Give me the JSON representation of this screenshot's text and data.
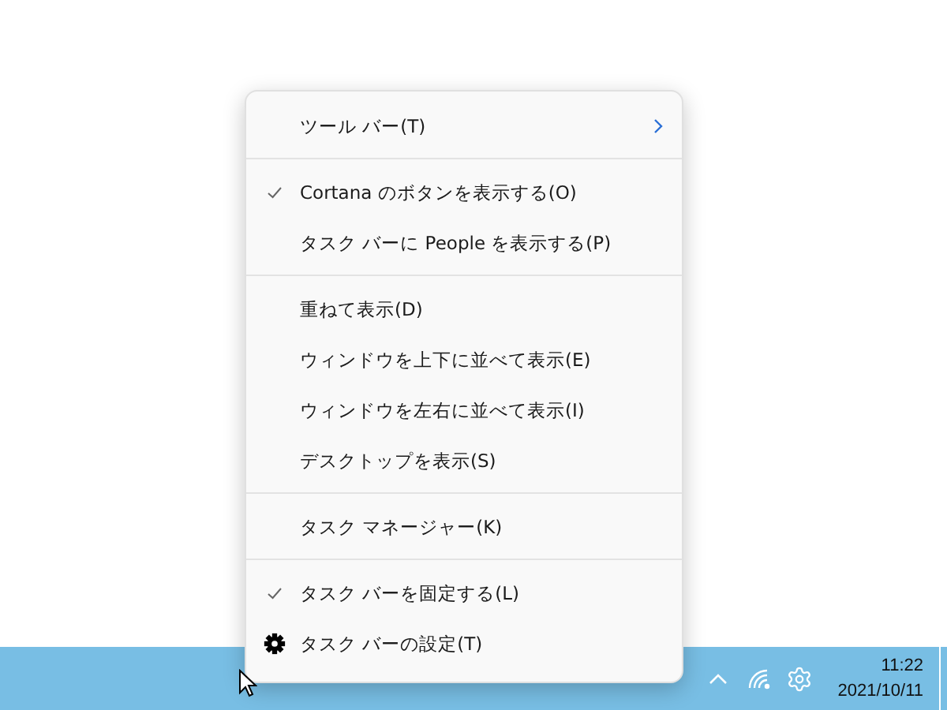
{
  "context_menu": {
    "items": [
      {
        "kind": "item",
        "label": "ツール バー(T)",
        "checked": false,
        "submenu": true,
        "icon": false
      },
      {
        "kind": "separator"
      },
      {
        "kind": "item",
        "label": "Cortana のボタンを表示する(O)",
        "checked": true,
        "submenu": false,
        "icon": false
      },
      {
        "kind": "item",
        "label": "タスク バーに People を表示する(P)",
        "checked": false,
        "submenu": false,
        "icon": false
      },
      {
        "kind": "separator"
      },
      {
        "kind": "item",
        "label": "重ねて表示(D)",
        "checked": false,
        "submenu": false,
        "icon": false
      },
      {
        "kind": "item",
        "label": "ウィンドウを上下に並べて表示(E)",
        "checked": false,
        "submenu": false,
        "icon": false
      },
      {
        "kind": "item",
        "label": "ウィンドウを左右に並べて表示(I)",
        "checked": false,
        "submenu": false,
        "icon": false
      },
      {
        "kind": "item",
        "label": "デスクトップを表示(S)",
        "checked": false,
        "submenu": false,
        "icon": false
      },
      {
        "kind": "separator"
      },
      {
        "kind": "item",
        "label": "タスク マネージャー(K)",
        "checked": false,
        "submenu": false,
        "icon": false
      },
      {
        "kind": "separator"
      },
      {
        "kind": "item",
        "label": "タスク バーを固定する(L)",
        "checked": true,
        "submenu": false,
        "icon": false
      },
      {
        "kind": "item",
        "label": "タスク バーの設定(T)",
        "checked": false,
        "submenu": false,
        "icon": true
      }
    ]
  },
  "taskbar": {
    "time": "11:22",
    "date": "2021/10/11"
  }
}
